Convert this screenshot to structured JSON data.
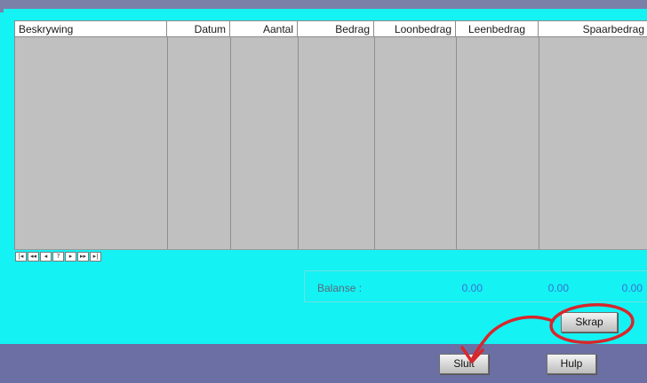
{
  "grid": {
    "columns": [
      {
        "key": "beskrywing",
        "label": "Beskrywing"
      },
      {
        "key": "datum",
        "label": "Datum"
      },
      {
        "key": "aantal",
        "label": "Aantal"
      },
      {
        "key": "bedrag",
        "label": "Bedrag"
      },
      {
        "key": "loonbedrag",
        "label": "Loonbedrag"
      },
      {
        "key": "leenbedrag",
        "label": "Leenbedrag"
      },
      {
        "key": "spaarbedrag",
        "label": "Spaarbedrag"
      }
    ],
    "rows": []
  },
  "navigator": {
    "buttons": [
      "first-icon",
      "prev-page-icon",
      "prev-icon",
      "help-icon",
      "next-icon",
      "next-page-icon",
      "last-icon"
    ],
    "glyphs": [
      "|◂",
      "◂◂",
      "◂",
      "?",
      "▸",
      "▸▸",
      "▸|"
    ]
  },
  "balance": {
    "label": "Balanse :",
    "values": [
      "0.00",
      "0.00",
      "0.00"
    ]
  },
  "buttons": {
    "skrap": "Skrap",
    "sluit": "Sluit",
    "hulp": "Hulp"
  },
  "colors": {
    "background": "#14f2f4",
    "grid": "#c0c0c0",
    "bottom_band": "#6b6fa3",
    "balance_values": "#3a73cf",
    "annotation": "#d8262b"
  }
}
